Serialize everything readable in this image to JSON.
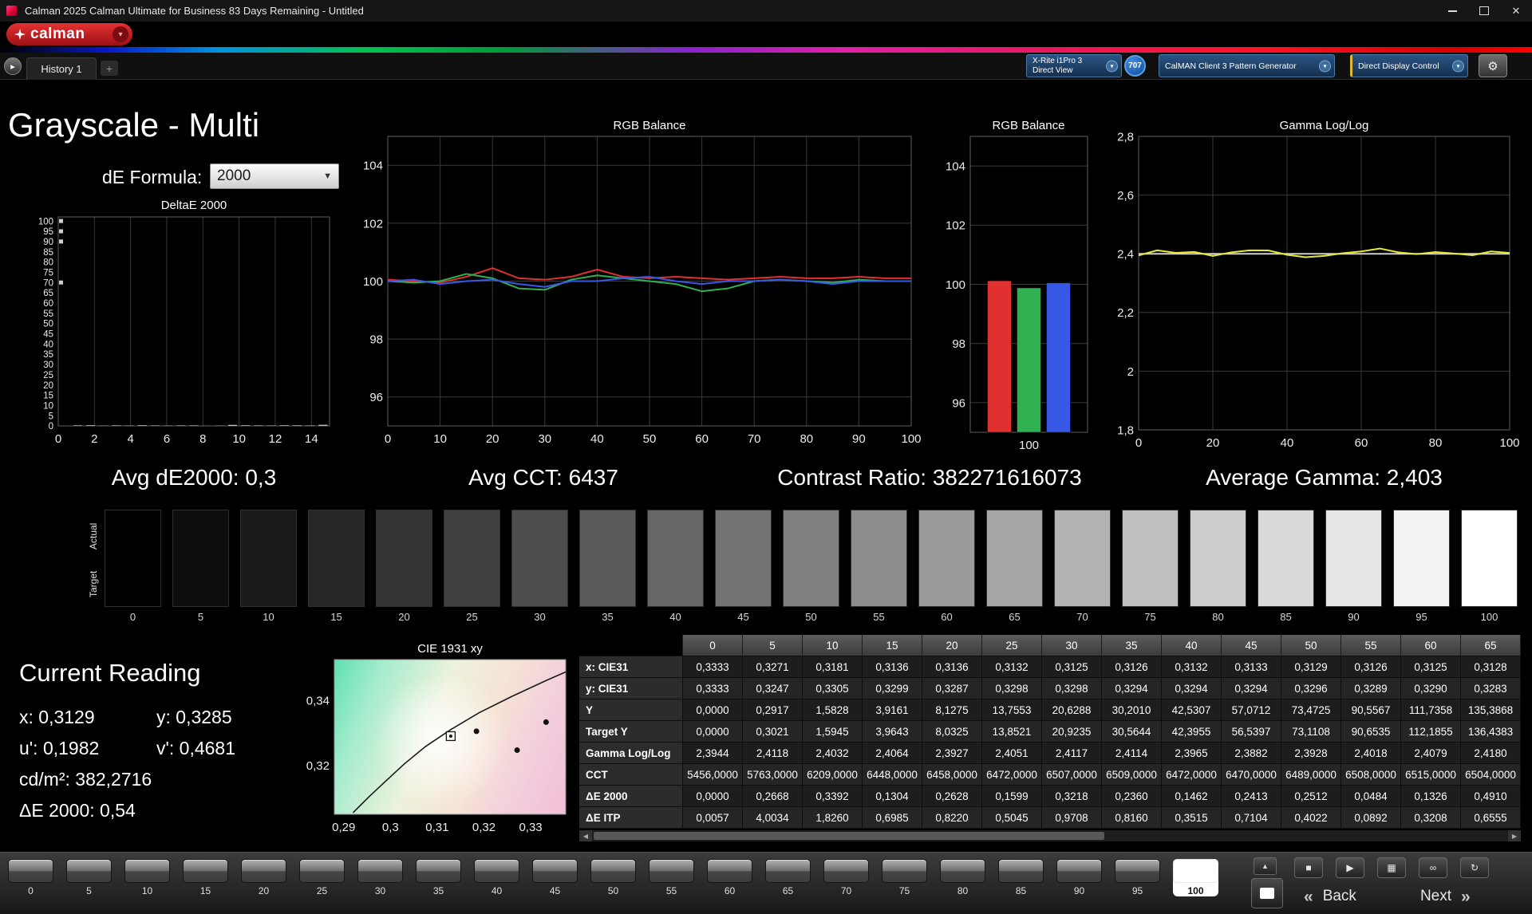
{
  "window": {
    "title": "Calman 2025 Calman Ultimate for Business 83 Days Remaining  - Untitled"
  },
  "icons": {
    "chevron_down": "▾",
    "chevron_down_dark": "▼",
    "gear": "⚙",
    "add": "+",
    "history_arrow": "▸",
    "close": "✕",
    "stop": "■",
    "play": "▶",
    "save": "▦",
    "loop": "∞",
    "refresh": "↻",
    "up": "▲",
    "back_chevrons": "«",
    "next_chevrons": "»",
    "scroll_left": "◀",
    "scroll_right": "▶"
  },
  "brand": {
    "logo": "calman"
  },
  "nav": {
    "history_tab": "History 1",
    "meter": {
      "line1": "X-Rite i1Pro 3",
      "line2": "Direct View"
    },
    "meter_badge": "707",
    "pattern_generator": "CalMAN Client 3 Pattern Generator",
    "display_control": "Direct Display Control"
  },
  "page": {
    "title": "Grayscale - Multi",
    "de_formula_label": "dE Formula:",
    "de_formula_value": "2000"
  },
  "stats": {
    "avg_de": "Avg dE2000: 0,3",
    "avg_cct": "Avg CCT: 6437",
    "contrast": "Contrast Ratio: 382271616073",
    "avg_gamma": "Average Gamma: 2,403"
  },
  "swatch_strip": {
    "row_labels": [
      "Actual",
      "Target"
    ],
    "levels": [
      0,
      5,
      10,
      15,
      20,
      25,
      30,
      35,
      40,
      45,
      50,
      55,
      60,
      65,
      70,
      75,
      80,
      85,
      90,
      95,
      100
    ]
  },
  "current_reading": {
    "title": "Current Reading",
    "x": "x: 0,3129",
    "y": "y: 0,3285",
    "u": "u': 0,1982",
    "v": "v': 0,4681",
    "cd": "cd/m²: 382,2716",
    "de": "ΔE 2000: 0,54"
  },
  "table": {
    "columns": [
      "0",
      "5",
      "10",
      "15",
      "20",
      "25",
      "30",
      "35",
      "40",
      "45",
      "50",
      "55",
      "60",
      "65"
    ],
    "rows": [
      {
        "label": "x: CIE31",
        "values": [
          "0,3333",
          "0,3271",
          "0,3181",
          "0,3136",
          "0,3136",
          "0,3132",
          "0,3125",
          "0,3126",
          "0,3132",
          "0,3133",
          "0,3129",
          "0,3126",
          "0,3125",
          "0,3128"
        ]
      },
      {
        "label": "y: CIE31",
        "values": [
          "0,3333",
          "0,3247",
          "0,3305",
          "0,3299",
          "0,3287",
          "0,3298",
          "0,3298",
          "0,3294",
          "0,3294",
          "0,3294",
          "0,3296",
          "0,3289",
          "0,3290",
          "0,3283"
        ]
      },
      {
        "label": "Y",
        "values": [
          "0,0000",
          "0,2917",
          "1,5828",
          "3,9161",
          "8,1275",
          "13,7553",
          "20,6288",
          "30,2010",
          "42,5307",
          "57,0712",
          "73,4725",
          "90,5567",
          "111,7358",
          "135,3868"
        ]
      },
      {
        "label": "Target Y",
        "values": [
          "0,0000",
          "0,3021",
          "1,5945",
          "3,9643",
          "8,0325",
          "13,8521",
          "20,9235",
          "30,5644",
          "42,3955",
          "56,5397",
          "73,1108",
          "90,6535",
          "112,1855",
          "136,4383"
        ]
      },
      {
        "label": "Gamma Log/Log",
        "values": [
          "2,3944",
          "2,4118",
          "2,4032",
          "2,4064",
          "2,3927",
          "2,4051",
          "2,4117",
          "2,4114",
          "2,3965",
          "2,3882",
          "2,3928",
          "2,4018",
          "2,4079",
          "2,4180"
        ]
      },
      {
        "label": "CCT",
        "values": [
          "5456,0000",
          "5763,0000",
          "6209,0000",
          "6448,0000",
          "6458,0000",
          "6472,0000",
          "6507,0000",
          "6509,0000",
          "6472,0000",
          "6470,0000",
          "6489,0000",
          "6508,0000",
          "6515,0000",
          "6504,0000"
        ]
      },
      {
        "label": "ΔE 2000",
        "values": [
          "0,0000",
          "0,2668",
          "0,3392",
          "0,1304",
          "0,2628",
          "0,1599",
          "0,3218",
          "0,2360",
          "0,1462",
          "0,2413",
          "0,2512",
          "0,0484",
          "0,1326",
          "0,4910"
        ]
      },
      {
        "label": "ΔE ITP",
        "values": [
          "0,0057",
          "4,0034",
          "1,8260",
          "0,6985",
          "0,8220",
          "0,5045",
          "0,9708",
          "0,8160",
          "0,3515",
          "0,7104",
          "0,4022",
          "0,0892",
          "0,3208",
          "0,6555"
        ]
      }
    ]
  },
  "bottom_bar": {
    "levels": [
      "0",
      "5",
      "10",
      "15",
      "20",
      "25",
      "30",
      "35",
      "40",
      "45",
      "50",
      "55",
      "60",
      "65",
      "70",
      "75",
      "80",
      "85",
      "90",
      "95",
      "100"
    ],
    "selected": "100",
    "back": "Back",
    "next": "Next"
  },
  "chart_data": [
    {
      "id": "deltae",
      "type": "bar",
      "title": "DeltaE 2000",
      "xlim": [
        0,
        15
      ],
      "ylim": [
        0,
        102
      ],
      "grid_v": true,
      "grid_h": false,
      "x_ticks": [
        [
          0,
          "0"
        ],
        [
          2,
          "2"
        ],
        [
          4,
          "4"
        ],
        [
          6,
          "6"
        ],
        [
          8,
          "8"
        ],
        [
          10,
          "10"
        ],
        [
          12,
          "12"
        ],
        [
          14,
          "14"
        ]
      ],
      "y_ticks": [
        [
          0,
          "0"
        ],
        [
          5,
          "5"
        ],
        [
          10,
          "10"
        ],
        [
          15,
          "15"
        ],
        [
          20,
          "20"
        ],
        [
          25,
          "25"
        ],
        [
          30,
          "30"
        ],
        [
          35,
          "35"
        ],
        [
          40,
          "40"
        ],
        [
          45,
          "45"
        ],
        [
          50,
          "50"
        ],
        [
          55,
          "55"
        ],
        [
          60,
          "60"
        ],
        [
          65,
          "65"
        ],
        [
          70,
          "70"
        ],
        [
          75,
          "75"
        ],
        [
          80,
          "80"
        ],
        [
          85,
          "85"
        ],
        [
          90,
          "90"
        ],
        [
          95,
          "95"
        ],
        [
          100,
          "100"
        ]
      ],
      "values": [
        0.0,
        0.2668,
        0.3392,
        0.1304,
        0.2628,
        0.1599,
        0.3218,
        0.236,
        0.1462,
        0.2413,
        0.2512,
        0.0484,
        0.1326,
        0.491,
        0.3,
        0.25,
        0.2,
        0.3,
        0.28,
        0.22,
        0.54
      ],
      "markers": [
        100,
        95,
        90,
        70
      ]
    },
    {
      "id": "rgb_line",
      "type": "line",
      "title": "RGB Balance",
      "xlim": [
        0,
        100
      ],
      "ylim": [
        95,
        105
      ],
      "grid_v": true,
      "grid_h": true,
      "x_ticks": [
        [
          0,
          "0"
        ],
        [
          10,
          "10"
        ],
        [
          20,
          "20"
        ],
        [
          30,
          "30"
        ],
        [
          40,
          "40"
        ],
        [
          50,
          "50"
        ],
        [
          60,
          "60"
        ],
        [
          70,
          "70"
        ],
        [
          80,
          "80"
        ],
        [
          90,
          "90"
        ],
        [
          100,
          "100"
        ]
      ],
      "y_ticks": [
        [
          96,
          "96"
        ],
        [
          98,
          "98"
        ],
        [
          100,
          "100"
        ],
        [
          102,
          "102"
        ],
        [
          104,
          "104"
        ]
      ],
      "x": [
        0,
        5,
        10,
        15,
        20,
        25,
        30,
        35,
        40,
        45,
        50,
        55,
        60,
        65,
        70,
        75,
        80,
        85,
        90,
        95,
        100
      ],
      "series": [
        {
          "name": "red",
          "color": "#e03030",
          "values": [
            100.05,
            100.0,
            99.95,
            100.15,
            100.45,
            100.1,
            100.05,
            100.15,
            100.4,
            100.15,
            100.1,
            100.15,
            100.1,
            100.05,
            100.1,
            100.15,
            100.1,
            100.1,
            100.15,
            100.1,
            100.1
          ]
        },
        {
          "name": "green",
          "color": "#30b050",
          "values": [
            100.0,
            99.95,
            100.0,
            100.25,
            100.1,
            99.75,
            99.7,
            100.05,
            100.2,
            100.1,
            100.0,
            99.9,
            99.65,
            99.75,
            100.0,
            100.05,
            100.0,
            99.95,
            100.05,
            100.0,
            100.0
          ]
        },
        {
          "name": "blue",
          "color": "#3858e8",
          "values": [
            100.0,
            100.05,
            99.9,
            100.0,
            100.05,
            99.9,
            99.8,
            100.0,
            100.0,
            100.1,
            100.15,
            100.0,
            99.9,
            100.0,
            100.0,
            100.05,
            100.0,
            99.9,
            100.0,
            100.0,
            100.0
          ]
        }
      ]
    },
    {
      "id": "rgb_bars",
      "type": "bar-group",
      "title": "RGB Balance",
      "xlim": [
        0,
        1
      ],
      "ylim": [
        95,
        105
      ],
      "grid_v": false,
      "grid_h": true,
      "x_ticks": [
        [
          0.5,
          "100"
        ]
      ],
      "y_ticks": [
        [
          96,
          "96"
        ],
        [
          98,
          "98"
        ],
        [
          100,
          "100"
        ],
        [
          102,
          "102"
        ],
        [
          104,
          "104"
        ]
      ],
      "bars": [
        {
          "name": "red",
          "color": "#e03030",
          "value": 100.12
        },
        {
          "name": "green",
          "color": "#30b050",
          "value": 99.88
        },
        {
          "name": "blue",
          "color": "#3858e8",
          "value": 100.05
        }
      ]
    },
    {
      "id": "gamma",
      "type": "line",
      "title": "Gamma Log/Log",
      "xlim": [
        0,
        100
      ],
      "ylim": [
        1.8,
        2.8
      ],
      "grid_v": true,
      "grid_h": true,
      "x_ticks": [
        [
          0,
          "0"
        ],
        [
          20,
          "20"
        ],
        [
          40,
          "40"
        ],
        [
          60,
          "60"
        ],
        [
          80,
          "80"
        ],
        [
          100,
          "100"
        ]
      ],
      "y_ticks": [
        [
          1.8,
          "1,8"
        ],
        [
          2.0,
          "2"
        ],
        [
          2.2,
          "2,2"
        ],
        [
          2.4,
          "2,4"
        ],
        [
          2.6,
          "2,6"
        ],
        [
          2.8,
          "2,8"
        ]
      ],
      "x": [
        0,
        5,
        10,
        15,
        20,
        25,
        30,
        35,
        40,
        45,
        50,
        55,
        60,
        65,
        70,
        75,
        80,
        85,
        90,
        95,
        100
      ],
      "series": [
        {
          "name": "target",
          "color": "#d0d0d0",
          "values": [
            2.4,
            2.4,
            2.4,
            2.4,
            2.4,
            2.4,
            2.4,
            2.4,
            2.4,
            2.4,
            2.4,
            2.4,
            2.4,
            2.4,
            2.4,
            2.4,
            2.4,
            2.4,
            2.4,
            2.4,
            2.4
          ]
        },
        {
          "name": "measured",
          "color": "#e8e838",
          "values": [
            2.3944,
            2.4118,
            2.4032,
            2.4064,
            2.3927,
            2.4051,
            2.4117,
            2.4114,
            2.3965,
            2.3882,
            2.3928,
            2.4018,
            2.4079,
            2.418,
            2.405,
            2.399,
            2.406,
            2.401,
            2.395,
            2.408,
            2.403
          ]
        }
      ]
    },
    {
      "id": "cie",
      "type": "scatter",
      "title": "CIE 1931 xy",
      "xlim": [
        0.288,
        0.3375
      ],
      "ylim": [
        0.305,
        0.3525
      ],
      "grid_v": false,
      "grid_h": false,
      "x_ticks": [
        [
          0.29,
          "0,29"
        ],
        [
          0.3,
          "0,3"
        ],
        [
          0.31,
          "0,31"
        ],
        [
          0.32,
          "0,32"
        ],
        [
          0.33,
          "0,33"
        ]
      ],
      "y_ticks": [
        [
          0.32,
          "0,32"
        ],
        [
          0.34,
          "0,34"
        ]
      ],
      "curve": [
        [
          0.292,
          0.3055
        ],
        [
          0.2955,
          0.3105
        ],
        [
          0.299,
          0.3152
        ],
        [
          0.303,
          0.3205
        ],
        [
          0.3075,
          0.3258
        ],
        [
          0.3129,
          0.331
        ],
        [
          0.319,
          0.3362
        ],
        [
          0.326,
          0.3412
        ],
        [
          0.3335,
          0.3462
        ],
        [
          0.3375,
          0.3487
        ]
      ],
      "points": [
        [
          0.3184,
          0.3305
        ],
        [
          0.3271,
          0.3247
        ],
        [
          0.3333,
          0.3333
        ]
      ],
      "reticle": [
        0.3129,
        0.329
      ]
    }
  ]
}
